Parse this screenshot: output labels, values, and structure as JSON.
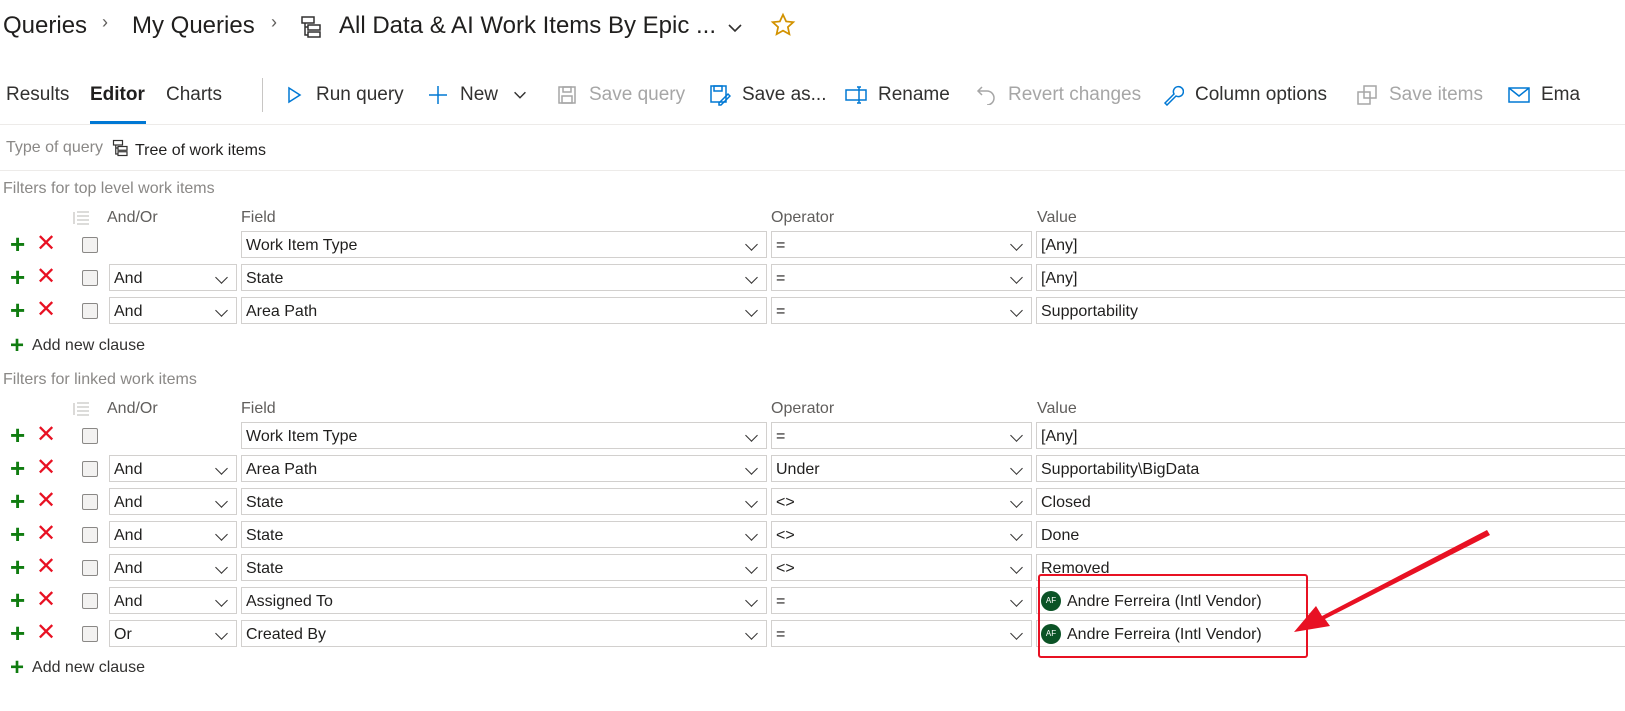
{
  "breadcrumb": {
    "root": "Queries",
    "folder": "My Queries",
    "query_title": "All Data & AI Work Items By Epic ..."
  },
  "tabs": [
    {
      "label": "Results"
    },
    {
      "label": "Editor"
    },
    {
      "label": "Charts"
    }
  ],
  "toolbar": {
    "run_query": "Run query",
    "new": "New",
    "save_query": "Save query",
    "save_as": "Save as...",
    "rename": "Rename",
    "revert_changes": "Revert changes",
    "column_options": "Column options",
    "save_items": "Save items",
    "email": "Ema"
  },
  "query_type": {
    "label": "Type of query",
    "value": "Tree of work items"
  },
  "top_filters": {
    "section_label": "Filters for top level work items",
    "headers": {
      "andor": "And/Or",
      "field": "Field",
      "operator": "Operator",
      "value": "Value"
    },
    "rows": [
      {
        "andor": "",
        "field": "Work Item Type",
        "operator": "=",
        "value": "[Any]"
      },
      {
        "andor": "And",
        "field": "State",
        "operator": "=",
        "value": "[Any]"
      },
      {
        "andor": "And",
        "field": "Area Path",
        "operator": "=",
        "value": "Supportability"
      }
    ],
    "add_clause": "Add new clause"
  },
  "linked_filters": {
    "section_label": "Filters for linked work items",
    "headers": {
      "andor": "And/Or",
      "field": "Field",
      "operator": "Operator",
      "value": "Value"
    },
    "rows": [
      {
        "andor": "",
        "field": "Work Item Type",
        "operator": "=",
        "value": "[Any]"
      },
      {
        "andor": "And",
        "field": "Area Path",
        "operator": "Under",
        "value": "Supportability\\BigData"
      },
      {
        "andor": "And",
        "field": "State",
        "operator": "<>",
        "value": "Closed"
      },
      {
        "andor": "And",
        "field": "State",
        "operator": "<>",
        "value": "Done"
      },
      {
        "andor": "And",
        "field": "State",
        "operator": "<>",
        "value": "Removed"
      },
      {
        "andor": "And",
        "field": "Assigned To",
        "operator": "=",
        "value": "Andre Ferreira (Intl Vendor)",
        "avatar": "AF"
      },
      {
        "andor": "Or",
        "field": "Created By",
        "operator": "=",
        "value": "Andre Ferreira (Intl Vendor)",
        "avatar": "AF"
      }
    ],
    "add_clause": "Add new clause"
  },
  "colors": {
    "accent": "#0078d4",
    "add": "#107c10",
    "remove": "#e81123",
    "annotation": "#e81123"
  }
}
